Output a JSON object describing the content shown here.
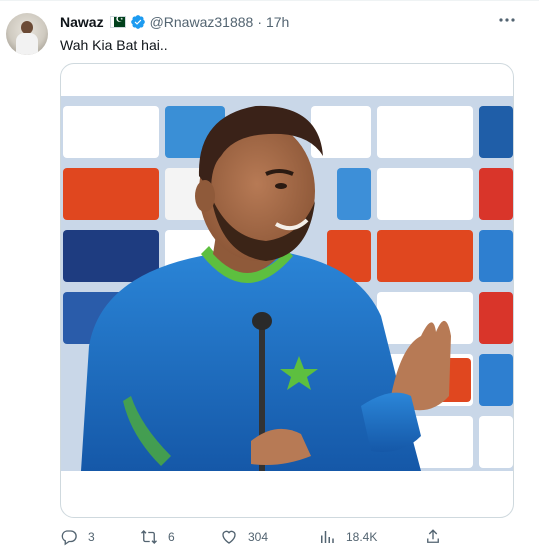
{
  "author": {
    "name": "Nawaz",
    "handle": "@Rnawaz31888",
    "separator": "·",
    "time": "17h",
    "flag_icon": "pakistan-flag-icon",
    "verified_icon": "verified-badge-icon"
  },
  "tweet": {
    "text": "Wah Kia Bat hai..",
    "media_alt": "Cricketer in a blue jersey with green collar smiling at a press conference with sponsor backdrop"
  },
  "actions": {
    "replies": "3",
    "retweets": "6",
    "likes": "304",
    "views": "18.4K"
  },
  "colors": {
    "text": "#0f1419",
    "muted": "#536471",
    "verified": "#1d9bf0",
    "border": "#cfd9de",
    "jersey": "#1f6fc4"
  }
}
